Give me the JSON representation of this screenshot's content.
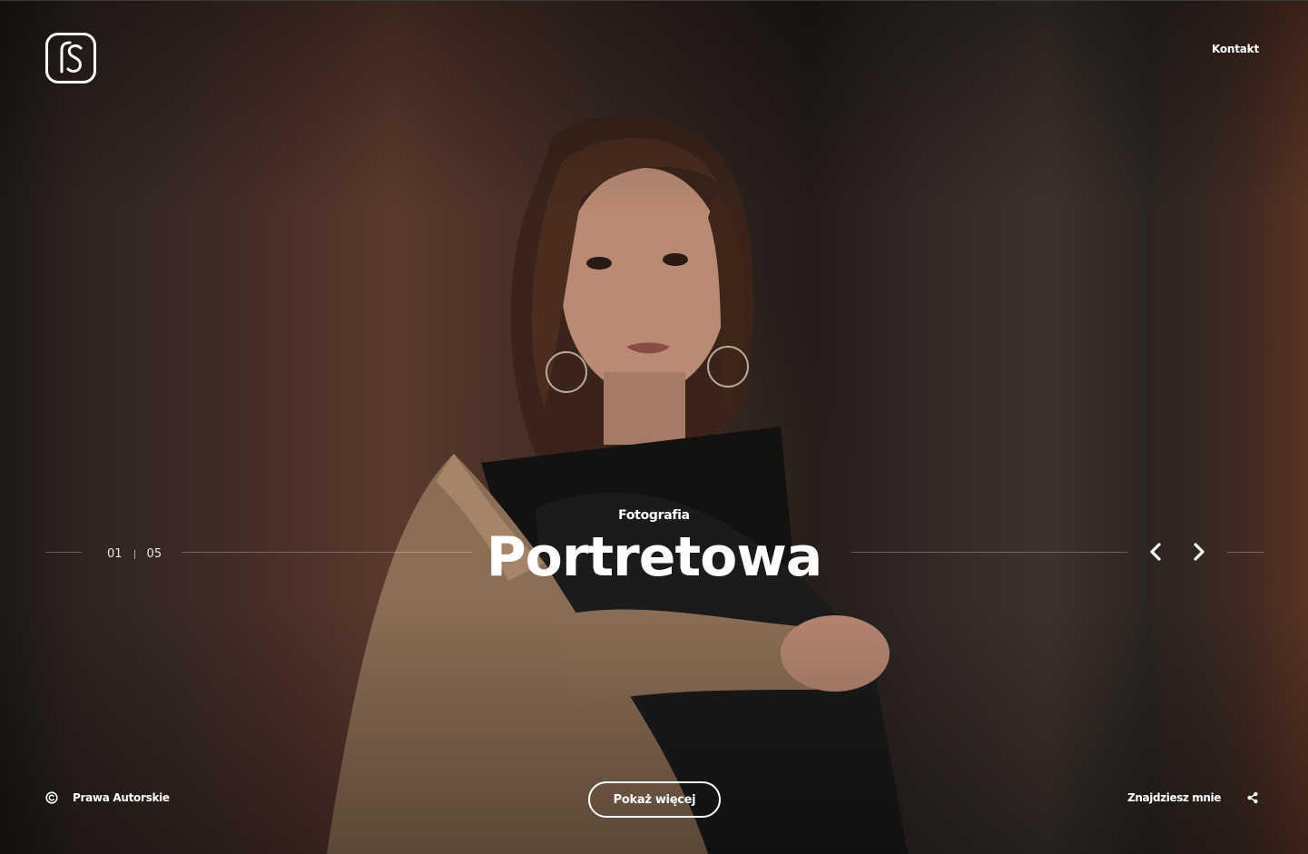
{
  "header": {
    "logo_icon": "fs-monogram-logo-icon",
    "contact_label": "Kontakt"
  },
  "slider": {
    "current": "01",
    "total": "05",
    "subtitle": "Fotografia",
    "title": "Portretowa",
    "prev_icon": "chevron-left-icon",
    "next_icon": "chevron-right-icon"
  },
  "footer": {
    "copyright_icon": "copyright-icon",
    "copyright_label": "Prawa Autorskie",
    "cta_label": "Pokaż więcej",
    "social_label": "Znajdziesz mnie",
    "social_icon": "share-icon"
  },
  "colors": {
    "text": "#ffffff",
    "background": "#2a211d",
    "divider": "#ffffff47"
  }
}
